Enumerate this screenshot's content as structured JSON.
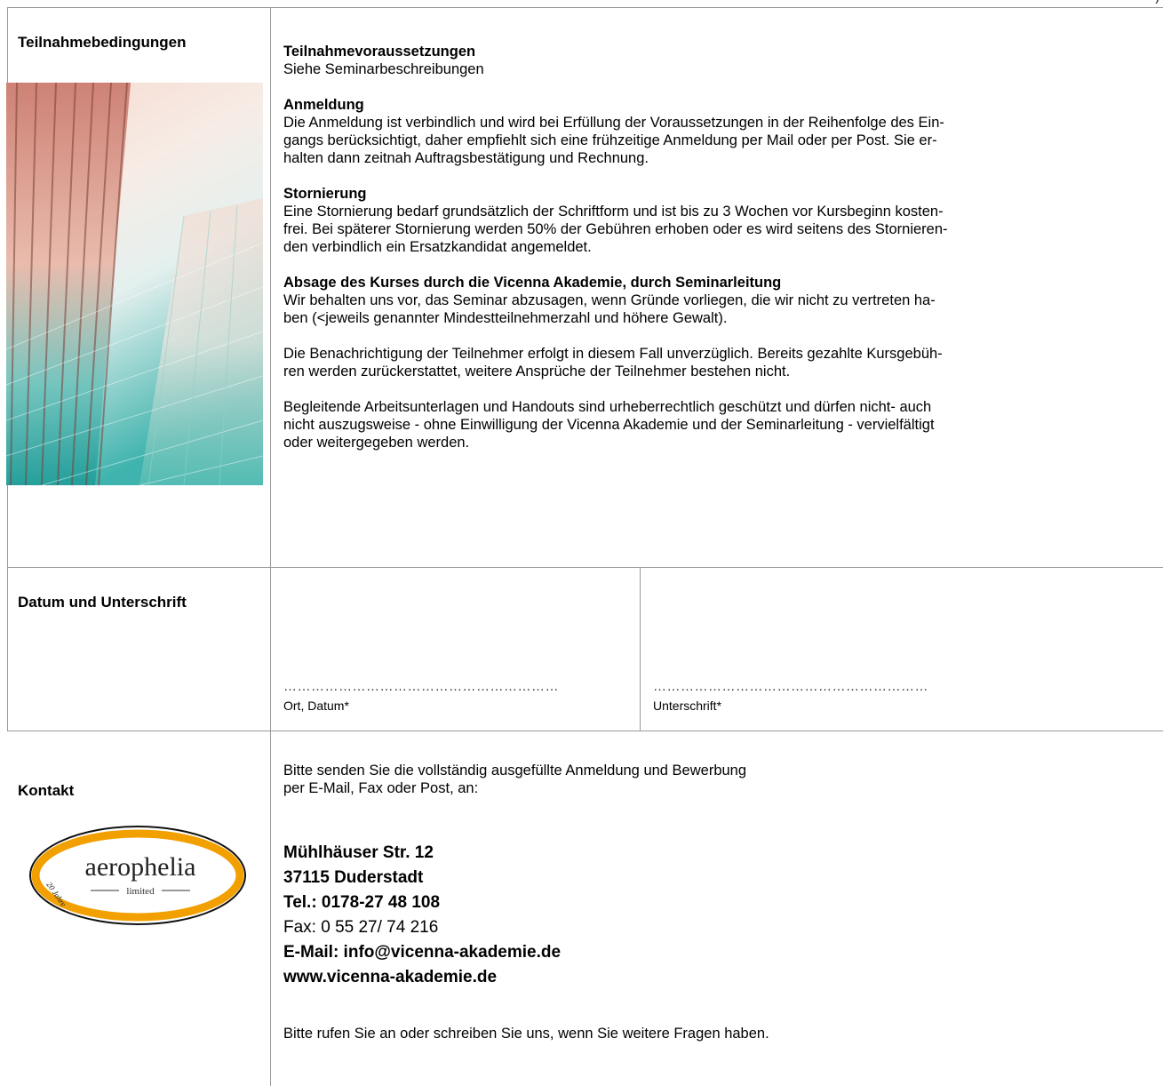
{
  "page": {
    "top_right_mark": ")"
  },
  "conditions": {
    "label": "Teilnahmebedingungen",
    "sections": [
      {
        "heading": "Teilnahmevoraussetzungen",
        "lines": [
          "Siehe Seminarbeschreibungen"
        ]
      },
      {
        "heading": "Anmeldung",
        "lines": [
          "Die Anmeldung ist verbindlich und wird bei Erfüllung der Voraussetzungen in der Reihenfolge des Ein-",
          "gangs berücksichtigt, daher empfiehlt sich eine frühzeitige Anmeldung per Mail oder per Post. Sie er-",
          "halten dann zeitnah Auftragsbestätigung und Rechnung."
        ]
      },
      {
        "heading": "Stornierung",
        "lines": [
          "Eine Stornierung bedarf grundsätzlich der Schriftform und ist bis zu 3 Wochen vor Kursbeginn kosten-",
          "frei. Bei späterer Stornierung werden 50% der Gebühren erhoben oder es wird seitens des Stornieren-",
          "den verbindlich ein Ersatzkandidat angemeldet."
        ]
      },
      {
        "heading": "Absage des Kurses durch die Vicenna Akademie, durch Seminarleitung",
        "lines": [
          "Wir behalten uns vor, das Seminar abzusagen, wenn Gründe vorliegen, die wir nicht zu vertreten ha-",
          "ben (<jeweils genannter Mindestteilnehmerzahl und höhere Gewalt)."
        ]
      },
      {
        "heading": "",
        "lines": [
          "Die Benachrichtigung der Teilnehmer erfolgt in diesem Fall unverzüglich. Bereits gezahlte Kursgebüh-",
          "ren werden zurückerstattet, weitere Ansprüche der Teilnehmer bestehen nicht."
        ]
      },
      {
        "heading": "",
        "lines": [
          "Begleitende Arbeitsunterlagen und Handouts sind urheberrechtlich geschützt und dürfen nicht- auch",
          "nicht auszugsweise - ohne Einwilligung der Vicenna Akademie und der Seminarleitung - vervielfältigt",
          "oder weitergegeben werden."
        ]
      }
    ]
  },
  "signature": {
    "label": "Datum und Unterschrift",
    "dots": "……………………………………………………",
    "place_date": "Ort, Datum*",
    "signature_field": "Unterschrift*"
  },
  "contact": {
    "label": "Kontakt",
    "logo": {
      "name": "aerophelia",
      "sub": "limited",
      "ribbon": "20 Jahre"
    },
    "intro_1": "Bitte senden Sie die vollständig ausgefüllte Anmeldung und Bewerbung",
    "intro_2": "per E-Mail, Fax oder Post, an:",
    "street": "Mühlhäuser Str. 12",
    "city": "37115 Duderstadt",
    "tel": "Tel.: 0178-27 48 108",
    "fax": "Fax: 0 55 27/ 74 216",
    "email": "E-Mail: info@vicenna-akademie.de",
    "web": "www.vicenna-akademie.de",
    "outro": "Bitte rufen Sie an oder schreiben Sie uns, wenn Sie weitere Fragen haben."
  },
  "colors": {
    "rule": "#9a9a9a",
    "logo_orange": "#f2a000"
  }
}
